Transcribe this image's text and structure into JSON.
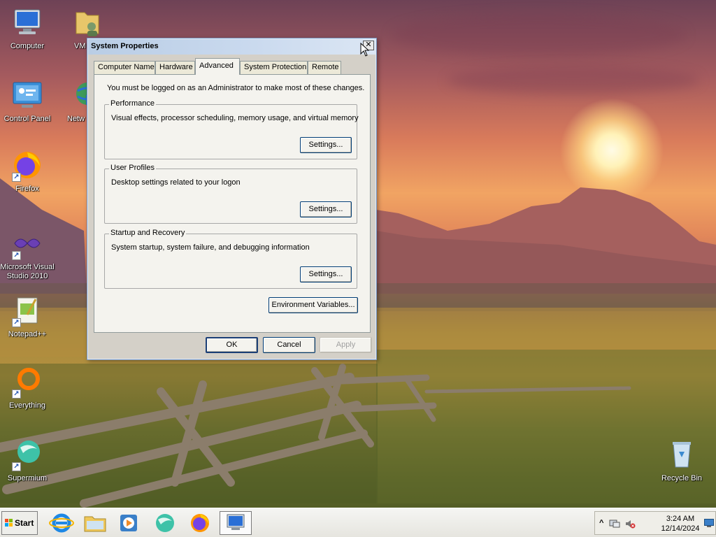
{
  "desktop": {
    "icons": [
      {
        "label": "Computer"
      },
      {
        "label": "VM"
      },
      {
        "label": "Control Panel"
      },
      {
        "label": "Netw"
      },
      {
        "label": "Firefox"
      },
      {
        "label": "Microsoft Visual Studio 2010"
      },
      {
        "label": "Notepad++"
      },
      {
        "label": "Everything"
      },
      {
        "label": "Supermium"
      },
      {
        "label": "Recycle Bin"
      }
    ]
  },
  "dialog": {
    "title": "System Properties",
    "close_glyph": "✕",
    "tabs": [
      {
        "label": "Computer Name",
        "active": false
      },
      {
        "label": "Hardware",
        "active": false
      },
      {
        "label": "Advanced",
        "active": true
      },
      {
        "label": "System Protection",
        "active": false
      },
      {
        "label": "Remote",
        "active": false
      }
    ],
    "notice": "You must be logged on as an Administrator to make most of these changes.",
    "groups": [
      {
        "title": "Performance",
        "description": "Visual effects, processor scheduling, memory usage, and virtual memory",
        "button": "Settings..."
      },
      {
        "title": "User Profiles",
        "description": "Desktop settings related to your logon",
        "button": "Settings..."
      },
      {
        "title": "Startup and Recovery",
        "description": "System startup, system failure, and debugging information",
        "button": "Settings..."
      }
    ],
    "env_button": "Environment Variables...",
    "ok_button": "OK",
    "cancel_button": "Cancel",
    "apply_button": "Apply"
  },
  "taskbar": {
    "start_label": "Start",
    "pinned": [
      "internet-explorer-icon",
      "explorer-folder-icon",
      "media-player-icon",
      "supermium-icon",
      "firefox-icon",
      "system-properties-icon"
    ],
    "clock_time": "3:24 AM",
    "clock_date": "12/14/2024",
    "tray_expand": "^"
  }
}
